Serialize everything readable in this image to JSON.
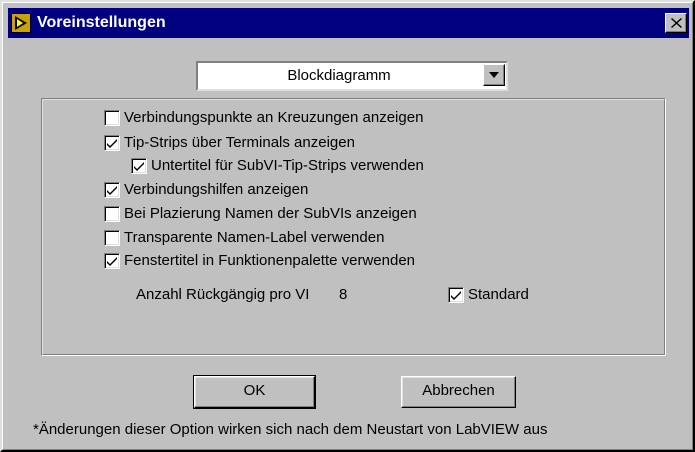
{
  "window": {
    "title": "Voreinstellungen",
    "app_icon": "labview-arrow-icon",
    "close_icon": "close-icon"
  },
  "category_dropdown": {
    "selected": "Blockdiagramm",
    "arrow_icon": "chevron-down-icon"
  },
  "options": [
    {
      "label": "Verbindungspunkte an Kreuzungen anzeigen",
      "checked": false
    },
    {
      "label": "Tip-Strips über Terminals anzeigen",
      "checked": true
    },
    {
      "label": "Untertitel für SubVI-Tip-Strips verwenden",
      "checked": true
    },
    {
      "label": "Verbindungshilfen anzeigen",
      "checked": true
    },
    {
      "label": "Bei Plazierung Namen der SubVIs anzeigen",
      "checked": false
    },
    {
      "label": "Transparente Namen-Label verwenden",
      "checked": false
    },
    {
      "label": "Fenstertitel in Funktionenpalette verwenden",
      "checked": true
    }
  ],
  "undo": {
    "label": "Anzahl Rückgängig pro VI",
    "value": "8",
    "default_label": "Standard",
    "default_checked": true
  },
  "buttons": {
    "ok": "OK",
    "cancel": "Abbrechen"
  },
  "footnote": "*Änderungen dieser Option wirken sich nach dem Neustart von LabVIEW aus",
  "colors": {
    "titlebar": "#000080",
    "face": "#c0c0c0",
    "app_icon": "#c9a400"
  }
}
